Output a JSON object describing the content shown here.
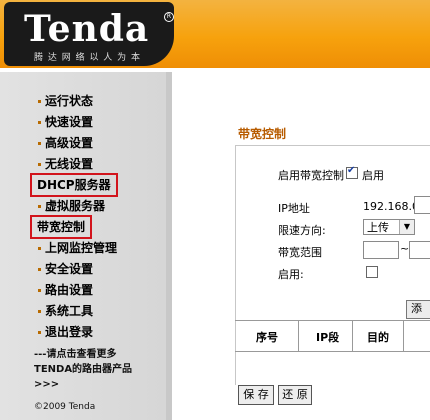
{
  "header": {
    "logo_text": "Tenda",
    "logo_tagline": "腾 达 网 络 以 人 为 本"
  },
  "sidebar": {
    "items": [
      {
        "label": "运行状态"
      },
      {
        "label": "快速设置"
      },
      {
        "label": "高级设置"
      },
      {
        "label": "无线设置"
      },
      {
        "label": "DHCP服务器"
      },
      {
        "label": "虚拟服务器"
      },
      {
        "label": "带宽控制"
      },
      {
        "label": "上网监控管理"
      },
      {
        "label": "安全设置"
      },
      {
        "label": "路由设置"
      },
      {
        "label": "系统工具"
      },
      {
        "label": "退出登录"
      }
    ],
    "promo_line1": "---请点击查看更多",
    "promo_line2": "TENDA的路由器产品",
    "promo_line3": ">>>",
    "copyright": "©2009 Tenda"
  },
  "main": {
    "title": "带宽控制",
    "enable_label": "启用带宽控制",
    "enable_value_label": "启用",
    "ip_label": "IP地址",
    "ip_value": "192.168.0.",
    "direction_label": "限速方向:",
    "direction_value": "上传",
    "range_label": "带宽范围",
    "range_separator": "~",
    "enable2_label": "启用:",
    "add_button": "添",
    "table_headers": [
      "序号",
      "IP段",
      "目的"
    ],
    "save_button": "保 存",
    "restore_button": "还 原"
  }
}
